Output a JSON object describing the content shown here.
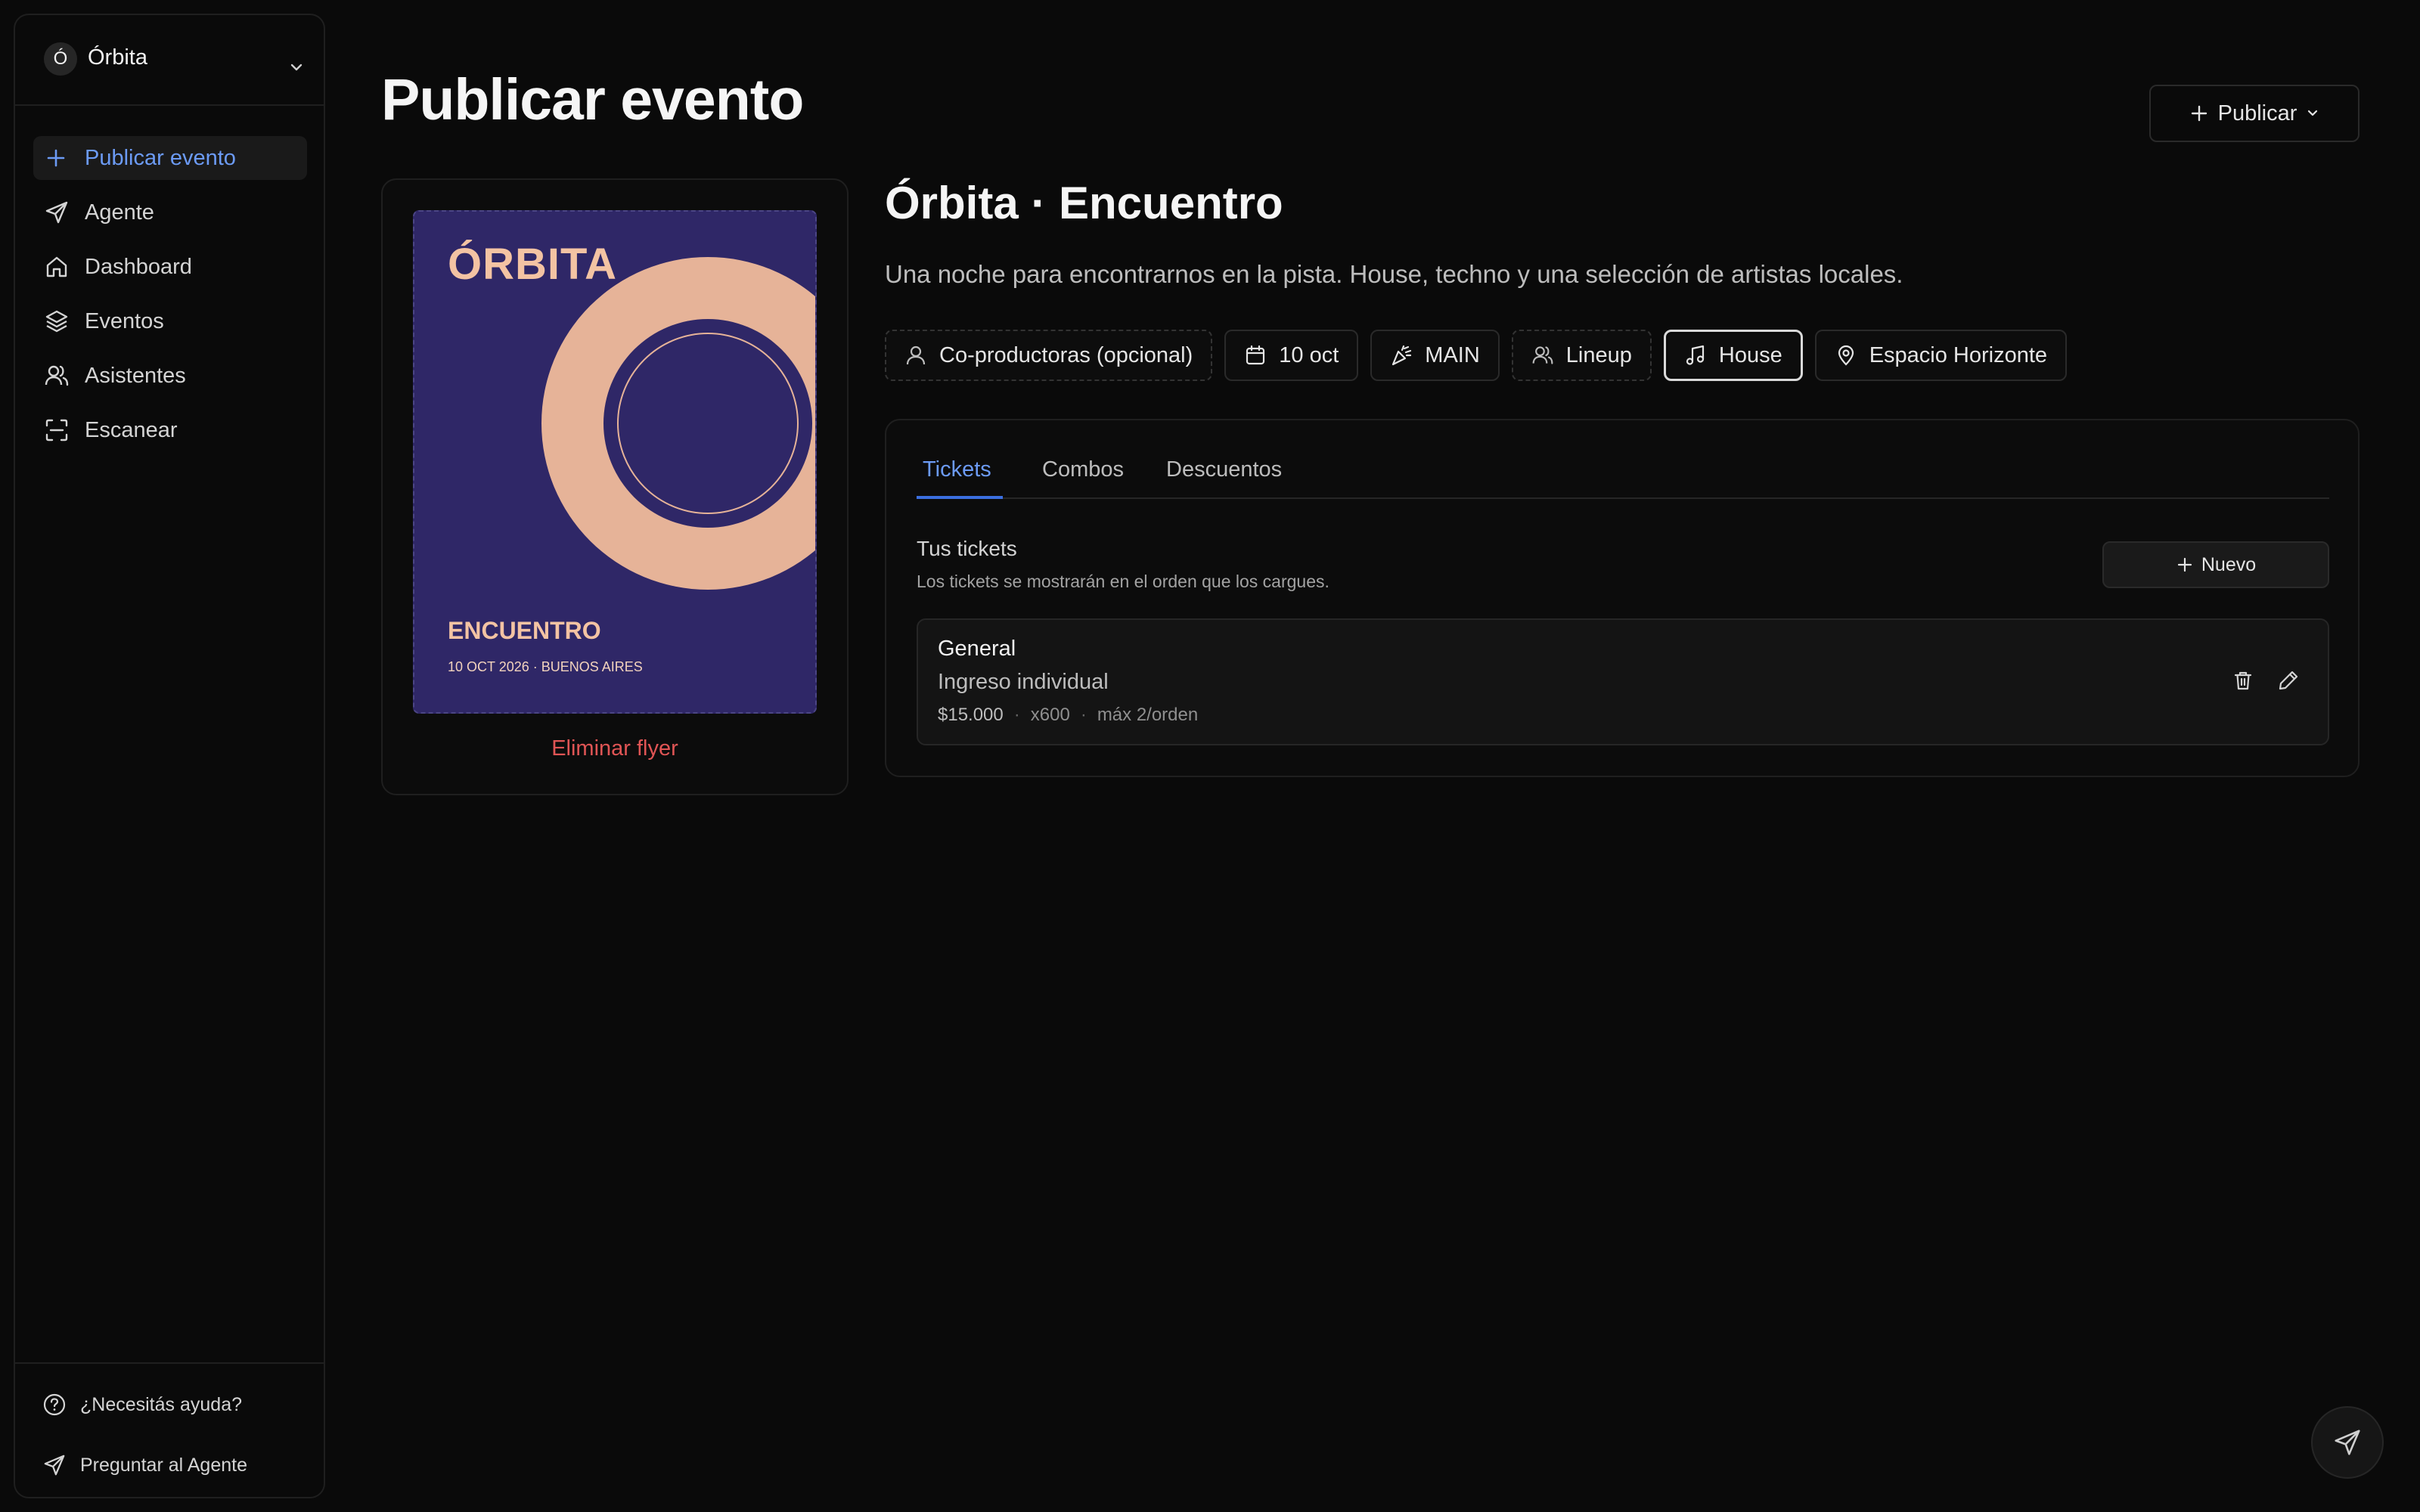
{
  "sidebar": {
    "org": {
      "initial": "Ó",
      "name": "Órbita"
    },
    "items": [
      {
        "label": "Publicar evento",
        "icon": "plus-icon",
        "active": true
      },
      {
        "label": "Agente",
        "icon": "send-icon"
      },
      {
        "label": "Dashboard",
        "icon": "home-icon"
      },
      {
        "label": "Eventos",
        "icon": "layers-icon"
      },
      {
        "label": "Asistentes",
        "icon": "users-icon"
      },
      {
        "label": "Escanear",
        "icon": "scan-icon"
      }
    ],
    "help": "¿Necesitás ayuda?",
    "ask_agent": "Preguntar al Agente"
  },
  "header": {
    "title": "Publicar evento",
    "publish_label": "Publicar"
  },
  "flyer": {
    "title": "ÓRBITA",
    "subtitle": "ENCUENTRO",
    "date_line": "10 OCT 2026 · BUENOS AIRES",
    "delete_label": "Eliminar flyer",
    "colors": {
      "background": "#2f2767",
      "accent": "#e6b398"
    }
  },
  "event": {
    "title": "Órbita · Encuentro",
    "description": "Una noche para encontrarnos en la pista. House, techno y una selección de artistas locales.",
    "chips": [
      {
        "label": "Co-productoras (opcional)",
        "icon": "user-icon",
        "style": "dashed"
      },
      {
        "label": "10 oct",
        "icon": "calendar-icon"
      },
      {
        "label": "MAIN",
        "icon": "party-icon"
      },
      {
        "label": "Lineup",
        "icon": "users-icon",
        "style": "dashed"
      },
      {
        "label": "House",
        "icon": "music-icon",
        "selected": true
      },
      {
        "label": "Espacio Horizonte",
        "icon": "map-pin-icon"
      }
    ]
  },
  "tabs": {
    "items": [
      "Tickets",
      "Combos",
      "Descuentos"
    ],
    "active": "Tickets"
  },
  "tickets": {
    "section_title": "Tus tickets",
    "section_subtitle": "Los tickets se mostrarán en el orden que los cargues.",
    "new_label": "Nuevo",
    "list": [
      {
        "name": "General",
        "type": "Ingreso individual",
        "price": "$15.000",
        "quantity": "x600",
        "limit": "máx 2/orden"
      }
    ]
  },
  "colors": {
    "accent": "#6c9bf5",
    "danger": "#e05555",
    "background": "#0a0a0a"
  }
}
